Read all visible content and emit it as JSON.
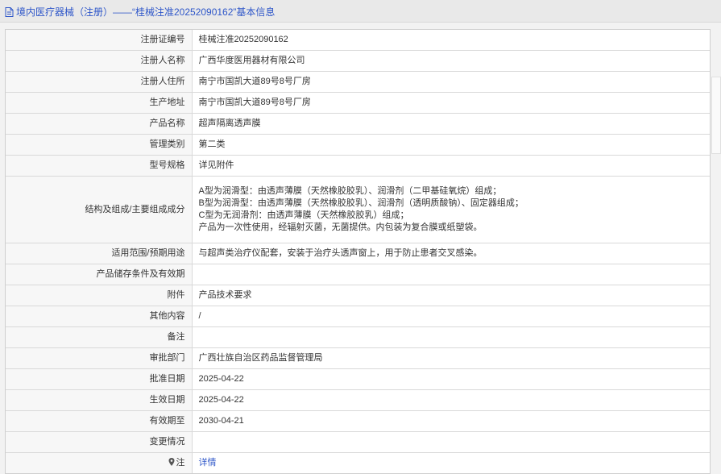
{
  "header": {
    "title": "境内医疗器械（注册）——“桂械注准20252090162”基本信息"
  },
  "rows": [
    {
      "label": "注册证编号",
      "value": "桂械注准20252090162"
    },
    {
      "label": "注册人名称",
      "value": "广西华度医用器材有限公司"
    },
    {
      "label": "注册人住所",
      "value": "南宁市国凯大道89号8号厂房"
    },
    {
      "label": "生产地址",
      "value": "南宁市国凯大道89号8号厂房"
    },
    {
      "label": "产品名称",
      "value": "超声隔离透声膜"
    },
    {
      "label": "管理类别",
      "value": "第二类"
    },
    {
      "label": "型号规格",
      "value": "详见附件"
    },
    {
      "label": "结构及组成/主要组成成分",
      "lines": [
        "A型为润滑型：由透声薄膜（天然橡胶胶乳）、润滑剂（二甲基硅氧烷）组成；",
        "B型为润滑型：由透声薄膜（天然橡胶胶乳）、润滑剂（透明质酸钠）、固定器组成；",
        "C型为无润滑剂：由透声薄膜（天然橡胶胶乳）组成；",
        "产品为一次性使用，经辐射灭菌，无菌提供。内包装为复合膜或纸塑袋。"
      ]
    },
    {
      "label": "适用范围/预期用途",
      "value": "与超声类治疗仪配套，安装于治疗头透声窗上，用于防止患者交叉感染。"
    },
    {
      "label": "产品储存条件及有效期",
      "value": ""
    },
    {
      "label": "附件",
      "value": "产品技术要求"
    },
    {
      "label": "其他内容",
      "value": "/"
    },
    {
      "label": "备注",
      "value": ""
    },
    {
      "label": "审批部门",
      "value": "广西壮族自治区药品监督管理局"
    },
    {
      "label": "批准日期",
      "value": "2025-04-22"
    },
    {
      "label": "生效日期",
      "value": "2025-04-22"
    },
    {
      "label": "有效期至",
      "value": "2030-04-21"
    },
    {
      "label": "变更情况",
      "value": ""
    },
    {
      "label": "注",
      "value": "详情"
    }
  ],
  "colors": {
    "link": "#2f57c9",
    "label_bg": "#f7f7f7",
    "border": "#d9d9d9"
  }
}
